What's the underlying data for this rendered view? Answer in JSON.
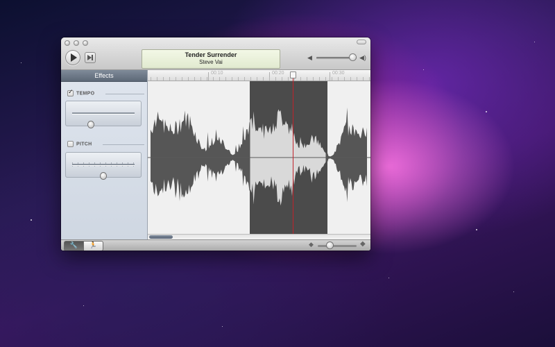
{
  "player": {
    "track_title": "Tender Surrender",
    "artist": "Steve Vai",
    "volume_level": 0.9
  },
  "sidebar": {
    "header": "Effects",
    "effects": [
      {
        "label": "TEMPO",
        "checked": true,
        "slider_value": 0.3
      },
      {
        "label": "PITCH",
        "checked": false,
        "slider_value": 0.5
      }
    ]
  },
  "timeline": {
    "ticks": [
      "00:10",
      "00:20",
      "00:30"
    ],
    "playhead_position": 0.64,
    "selection_start": 0.46,
    "selection_end": 0.81
  },
  "bottom_bar": {
    "modes": [
      {
        "name": "edit",
        "icon": "wrench-icon",
        "glyph": "🔧",
        "active": true
      },
      {
        "name": "run",
        "icon": "running-figure-icon",
        "glyph": "🏃",
        "active": false
      }
    ],
    "zoom_level": 0.3
  },
  "colors": {
    "playhead": "#c0232b",
    "selection": "#4b4b4b",
    "lcd_bg": "#eef3df"
  }
}
